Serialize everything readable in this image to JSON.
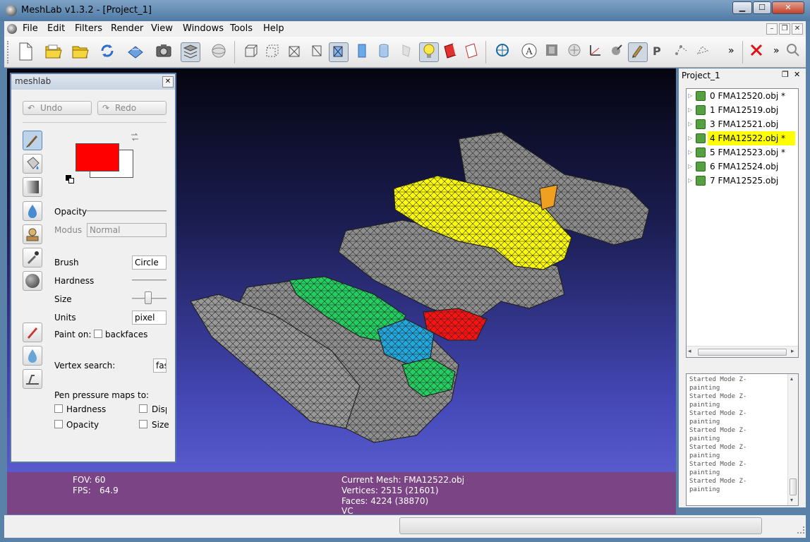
{
  "window": {
    "title": "MeshLab v1.3.2 - [Project_1]",
    "min": "▁",
    "max": "☐",
    "close": "✕"
  },
  "menu": [
    "File",
    "Edit",
    "Filters",
    "Render",
    "View",
    "Windows",
    "Tools",
    "Help"
  ],
  "mdi": {
    "min": "–",
    "restore": "❐",
    "close": "✕"
  },
  "toolbar": {
    "more1": "»",
    "more2": "»"
  },
  "paint_panel": {
    "title": "meshlab",
    "close": "✕",
    "undo": "Undo",
    "redo": "Redo",
    "primary_color": "#ff0000",
    "secondary_color": "#ffffff",
    "opacity_label": "Opacity",
    "modus_label": "Modus",
    "modus_value": "Normal",
    "brush_label": "Brush",
    "brush_value": "Circle",
    "hardness_label": "Hardness",
    "size_label": "Size",
    "size_level": 0.45,
    "units_label": "Units",
    "units_value": "pixel",
    "paint_on_label": "Paint on:",
    "backfaces_label": "backfaces",
    "vertex_search_label": "Vertex search:",
    "vertex_search_value": "fas",
    "pen_pressure_label": "Pen pressure maps to:",
    "pressure_opts": [
      "Hardness",
      "Disp",
      "Opacity",
      "Size"
    ]
  },
  "layer_panel": {
    "title": "Project_1",
    "float": "❐",
    "close": "✕",
    "layers": [
      {
        "index": "0",
        "name": "FMA12520.obj",
        "mod": "*",
        "selected": false
      },
      {
        "index": "1",
        "name": "FMA12519.obj",
        "mod": "",
        "selected": false
      },
      {
        "index": "3",
        "name": "FMA12521.obj",
        "mod": "",
        "selected": false
      },
      {
        "index": "4",
        "name": "FMA12522.obj",
        "mod": "*",
        "selected": true
      },
      {
        "index": "5",
        "name": "FMA12523.obj",
        "mod": "*",
        "selected": false
      },
      {
        "index": "6",
        "name": "FMA12524.obj",
        "mod": "",
        "selected": false
      },
      {
        "index": "7",
        "name": "FMA12525.obj",
        "mod": "",
        "selected": false
      }
    ],
    "log": [
      "Started Mode Z-",
      "painting",
      "Started Mode Z-",
      "painting",
      "Started Mode Z-",
      "painting",
      "Started Mode Z-",
      "painting",
      "Started Mode Z-",
      "painting",
      "Started Mode Z-",
      "painting",
      "Started Mode Z-",
      "painting"
    ]
  },
  "info": {
    "fov": "FOV: 60",
    "fps_label": "FPS:",
    "fps_value": "64.9",
    "current_mesh": "Current Mesh: FMA12522.obj",
    "vertices": "Vertices: 2515 (21601)",
    "faces": "Faces: 4224 (38870)",
    "vc": "VC"
  },
  "colors": {
    "selection": "#ffff00",
    "info_bg": "#7b4585"
  }
}
